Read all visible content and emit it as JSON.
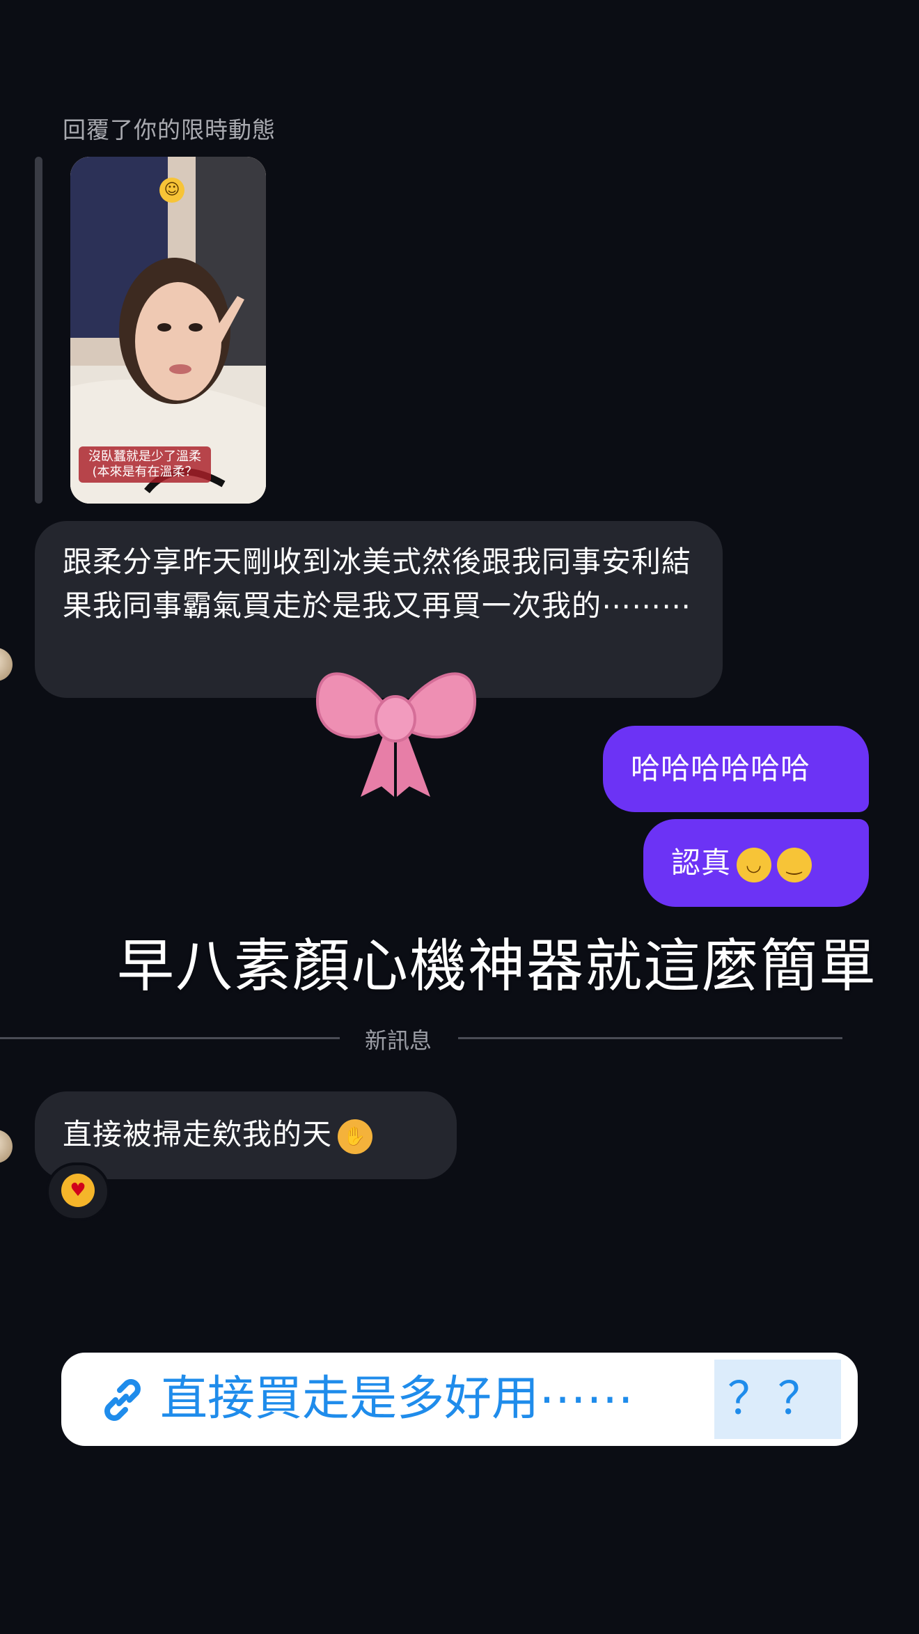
{
  "thread": {
    "reply_label": "回覆了你的限時動態",
    "story": {
      "caption_line1": "沒臥蠶就是少了溫柔",
      "caption_line2": "(本來是有在溫柔？"
    },
    "received_1": "跟柔分享昨天剛收到冰美式然後跟我同事安利結果我同事霸氣買走於是我又再買一次我的⋯⋯⋯",
    "sent_1": "哈哈哈哈哈哈",
    "sent_2": "認真",
    "divider": "新訊息",
    "received_2": "直接被掃走欸我的天",
    "reaction_icon": "heart-eyes-emoji"
  },
  "overlay": {
    "title": "早八素顏心機神器就這麼簡單",
    "bow_icon": "pink-ribbon-bow",
    "link_sticker": {
      "text": "直接買走是多好用⋯⋯",
      "suffix": "？？",
      "color": "#1f8ceb"
    }
  },
  "colors": {
    "background": "#0b0d14",
    "incoming_bubble": "#24262e",
    "outgoing_bubble": "#6c33f5"
  }
}
